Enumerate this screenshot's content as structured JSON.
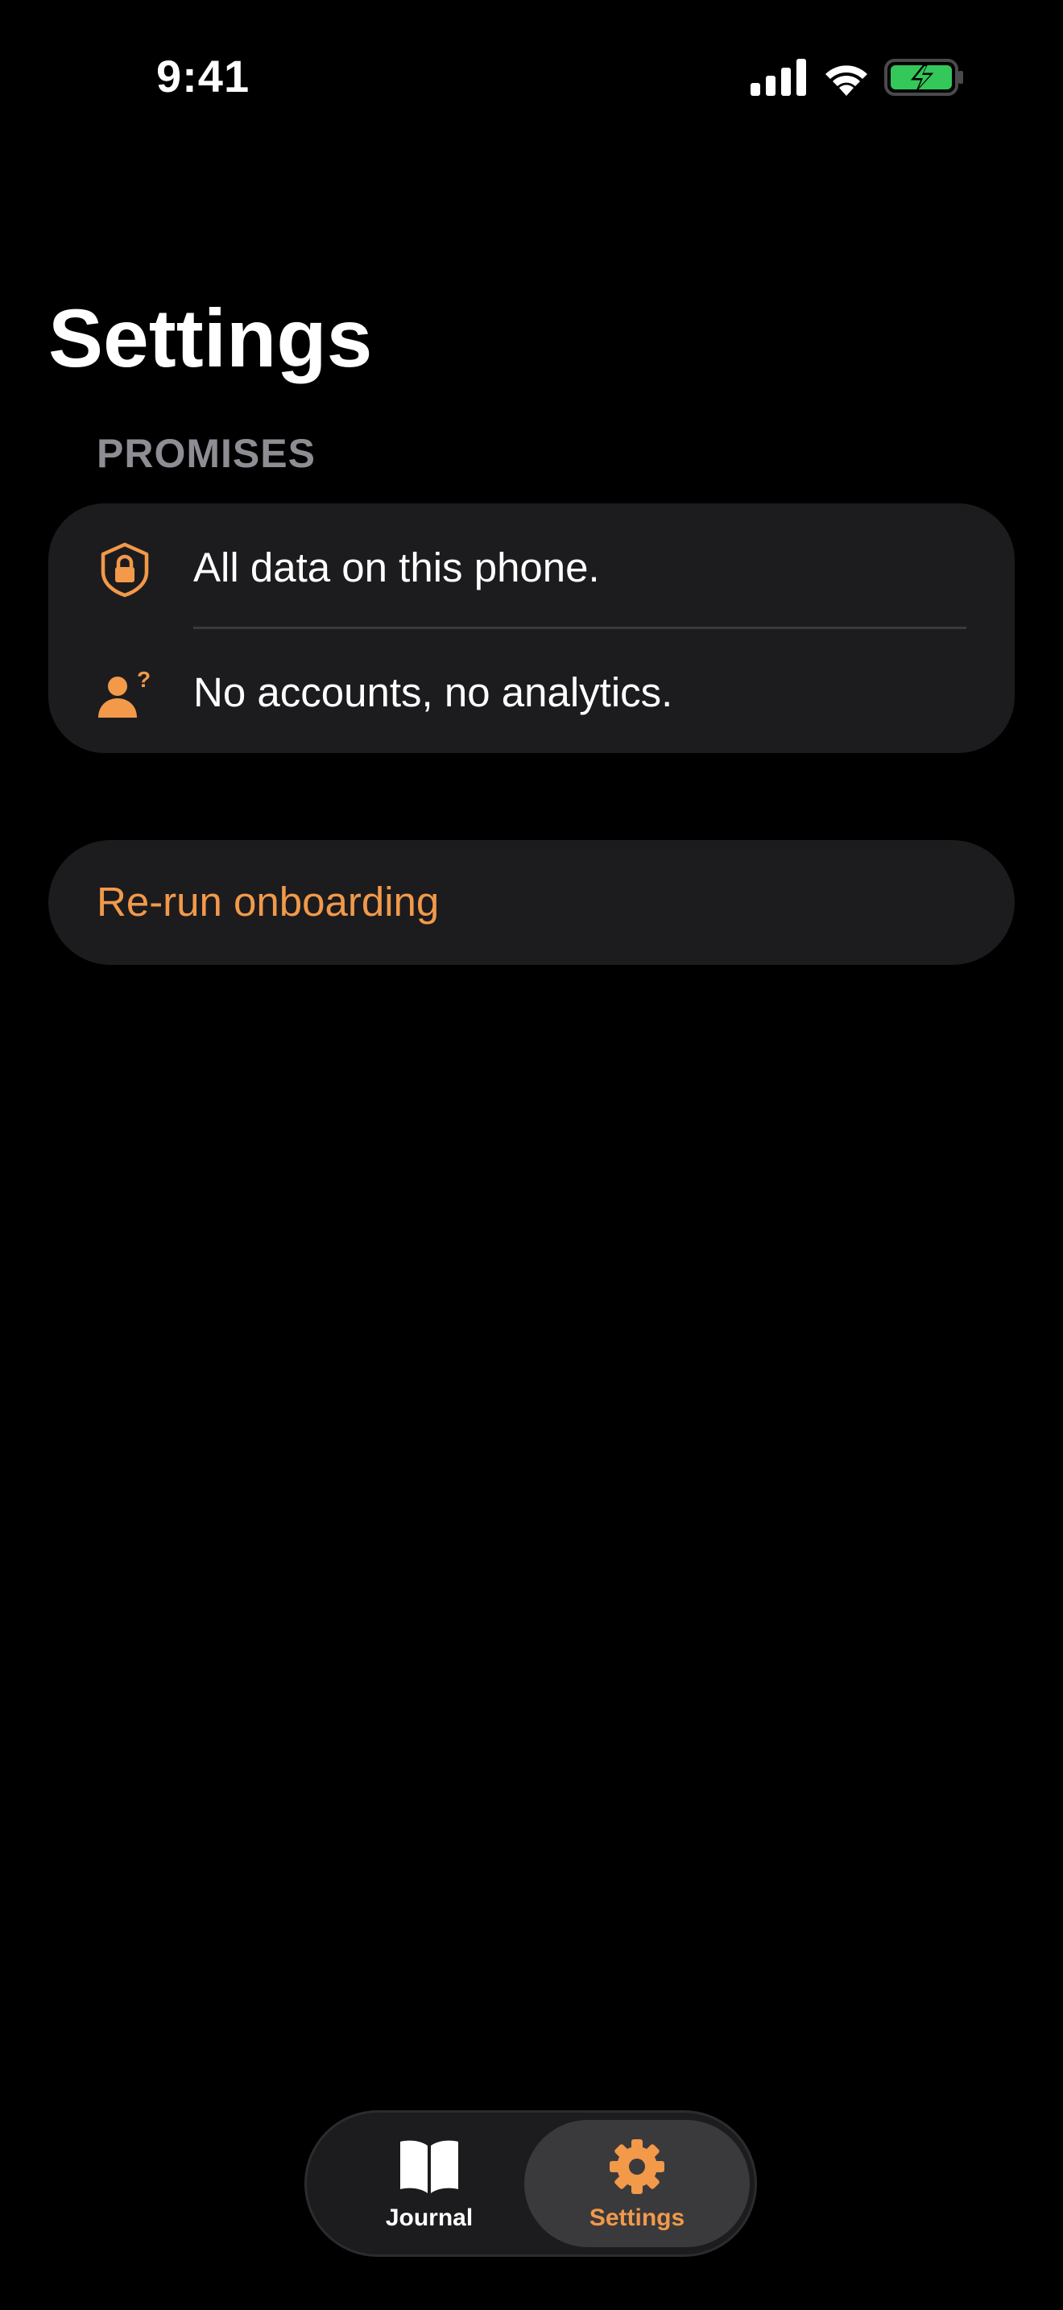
{
  "status_bar": {
    "time": "9:41"
  },
  "page": {
    "title": "Settings"
  },
  "promises": {
    "header": "PROMISES",
    "items": [
      {
        "label": "All data on this phone.",
        "icon": "lock-shield-icon"
      },
      {
        "label": "No accounts, no analytics.",
        "icon": "person-question-icon"
      }
    ]
  },
  "actions": {
    "rerun_onboarding_label": "Re-run onboarding"
  },
  "tab_bar": {
    "tabs": [
      {
        "label": "Journal",
        "icon": "book-icon",
        "selected": false
      },
      {
        "label": "Settings",
        "icon": "gear-icon",
        "selected": true
      }
    ]
  },
  "colors": {
    "accent": "#f2994a",
    "background": "#000000",
    "card": "#1c1c1e",
    "secondary_text": "#8d8d93",
    "battery_fill": "#34c759"
  }
}
